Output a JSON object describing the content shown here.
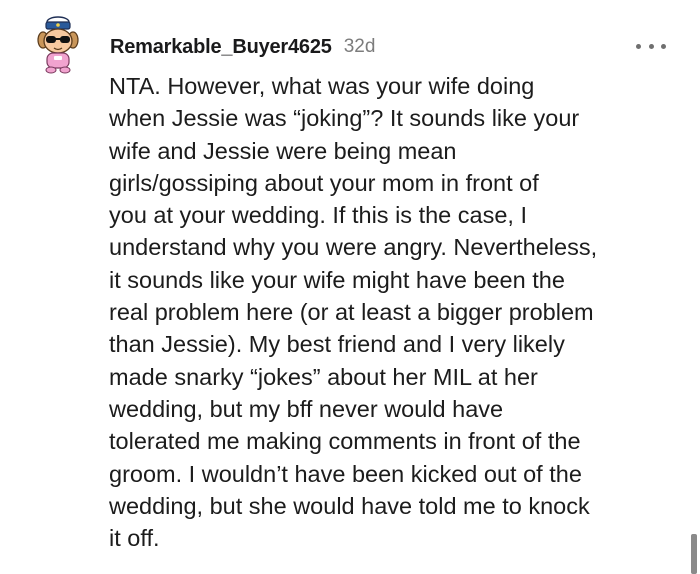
{
  "comment": {
    "author": "Remarkable_Buyer4625",
    "age": "32d",
    "avatar_icon": "snoo-avatar-with-sunglasses-and-captain-hat-icon",
    "more_icon": "more-options-horizontal-dots-icon",
    "body_lines": [
      "NTA. However, what was your wife doing",
      "when Jessie was “joking”? It sounds like your",
      "wife and Jessie were being mean",
      "girls/gossiping about your mom in front of",
      "you at your wedding. If this is the case, I",
      "understand why you were angry. Nevertheless,",
      "it sounds like your wife might have been the",
      "real problem here (or at least a bigger problem",
      "than Jessie). My best friend and I very likely",
      "made snarky “jokes” about her MIL at her",
      "wedding, but my bff never would have",
      "tolerated me making comments in front of the",
      "groom. I wouldn’t have been kicked out of the",
      "wedding, but she would have told me to knock",
      "it off."
    ]
  },
  "colors": {
    "background": "#ffffff",
    "text": "#1c1c1c",
    "meta": "#7c7c7c",
    "avatar_skin": "#f7c9a0",
    "avatar_hat": "#2a5a9a",
    "avatar_shirt": "#f1a3cf"
  }
}
